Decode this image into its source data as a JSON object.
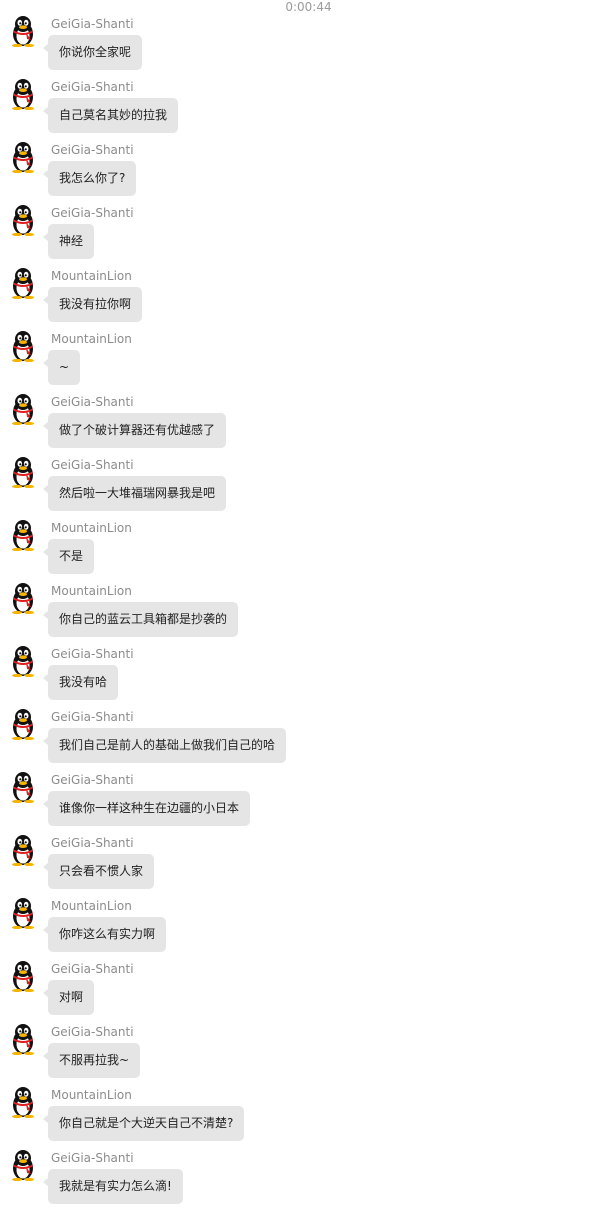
{
  "header": {
    "timestamp": "0:00:44"
  },
  "colors": {
    "bubble": "#e5e5e5",
    "name": "#8c8c8c",
    "timestamp": "#9b9b9b"
  },
  "avatar_icon": "qq-penguin-icon",
  "messages": [
    {
      "sender": "GeiGia-Shanti",
      "text": "你说你全家呢"
    },
    {
      "sender": "GeiGia-Shanti",
      "text": "自己莫名其妙的拉我"
    },
    {
      "sender": "GeiGia-Shanti",
      "text": "我怎么你了?"
    },
    {
      "sender": "GeiGia-Shanti",
      "text": "神经"
    },
    {
      "sender": "MountainLion",
      "text": "我没有拉你啊"
    },
    {
      "sender": "MountainLion",
      "text": "~"
    },
    {
      "sender": "GeiGia-Shanti",
      "text": "做了个破计算器还有优越感了"
    },
    {
      "sender": "GeiGia-Shanti",
      "text": "然后啦一大堆福瑞网暴我是吧"
    },
    {
      "sender": "MountainLion",
      "text": "不是"
    },
    {
      "sender": "MountainLion",
      "text": "你自己的蓝云工具箱都是抄袭的"
    },
    {
      "sender": "GeiGia-Shanti",
      "text": "我没有哈"
    },
    {
      "sender": "GeiGia-Shanti",
      "text": "我们自己是前人的基础上做我们自己的哈"
    },
    {
      "sender": "GeiGia-Shanti",
      "text": "谁像你一样这种生在边疆的小日本"
    },
    {
      "sender": "GeiGia-Shanti",
      "text": "只会看不惯人家"
    },
    {
      "sender": "MountainLion",
      "text": "你咋这么有实力啊"
    },
    {
      "sender": "GeiGia-Shanti",
      "text": "对啊"
    },
    {
      "sender": "GeiGia-Shanti",
      "text": "不服再拉我~"
    },
    {
      "sender": "MountainLion",
      "text": "你自己就是个大逆天自己不清楚?"
    },
    {
      "sender": "GeiGia-Shanti",
      "text": "我就是有实力怎么滴!"
    }
  ]
}
